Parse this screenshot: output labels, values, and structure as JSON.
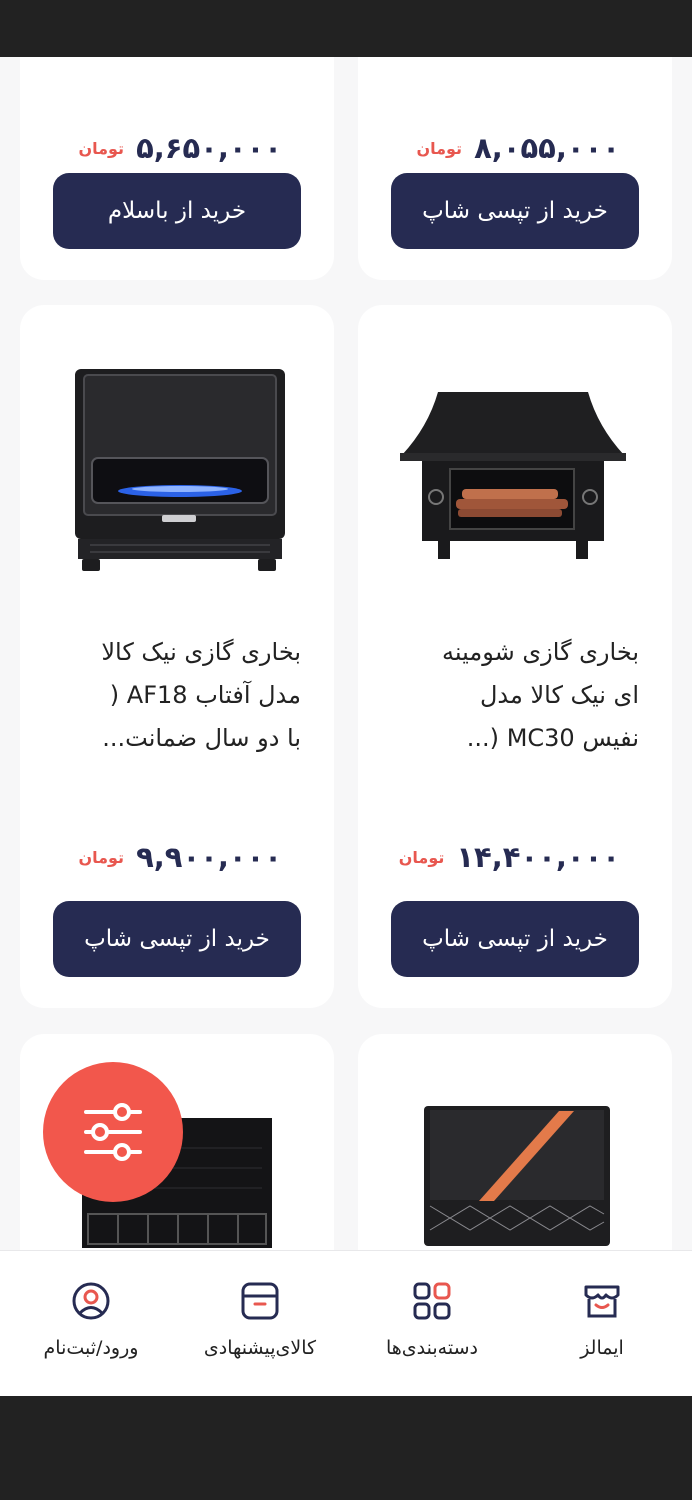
{
  "currency_label": "تومان",
  "top_row": [
    {
      "price": "۵,۶۵۰,۰۰۰",
      "button_label": "خرید از باسلام"
    },
    {
      "price": "۸,۰۵۵,۰۰۰",
      "button_label": "خرید از تپسی شاپ"
    }
  ],
  "middle_row": [
    {
      "title_lines": [
        "بخاری گازی نیک کالا",
        "مدل آفتاب AF18 (",
        "با دو سال ضمانت..."
      ],
      "price": "۹,۹۰۰,۰۰۰",
      "button_label": "خرید از تپسی شاپ",
      "image": "gas-heater-black-blue-flame"
    },
    {
      "title_lines": [
        "بخاری گازی شومینه",
        "ای نیک کالا مدل",
        "نفیس MC30 (..."
      ],
      "price": "۱۴,۴۰۰,۰۰۰",
      "button_label": "خرید از تپسی شاپ",
      "image": "fireplace-heater-black-roof"
    }
  ],
  "bottom_row_images": [
    "black-heater-grill",
    "nikkala-heater-boxed"
  ],
  "filter_button_icon": "sliders-icon",
  "bottom_nav": [
    {
      "label": "ورود/ثبت‌نام",
      "icon": "user-circle-icon"
    },
    {
      "label": "کالای‌پیشنهادی",
      "icon": "box-icon"
    },
    {
      "label": "دسته‌بندی‌ها",
      "icon": "grid-icon"
    },
    {
      "label": "ایمالز",
      "icon": "store-icon"
    }
  ],
  "colors": {
    "primary": "#262b52",
    "accent": "#e8574f",
    "fab": "#f2574c",
    "background": "#f7f7f8"
  }
}
